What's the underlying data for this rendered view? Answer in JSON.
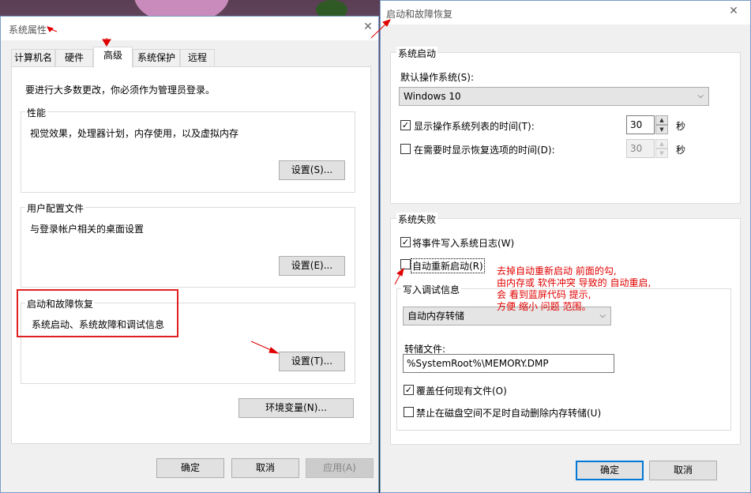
{
  "sys_props": {
    "title": "系统属性",
    "tabs": [
      "计算机名",
      "硬件",
      "高级",
      "系统保护",
      "远程"
    ],
    "admin_notice": "要进行大多数更改，你必须作为管理员登录。",
    "performance": {
      "label": "性能",
      "desc": "视觉效果，处理器计划，内存使用，以及虚拟内存",
      "button": "设置(S)..."
    },
    "user_profiles": {
      "label": "用户配置文件",
      "desc": "与登录帐户相关的桌面设置",
      "button": "设置(E)..."
    },
    "startup_recovery": {
      "label": "启动和故障恢复",
      "desc": "系统启动、系统故障和调试信息",
      "button": "设置(T)..."
    },
    "env_button": "环境变量(N)...",
    "ok": "确定",
    "cancel": "取消",
    "apply": "应用(A)"
  },
  "startup_dialog": {
    "title": "启动和故障恢复",
    "system_startup": {
      "label": "系统启动",
      "default_os_label": "默认操作系统(S):",
      "default_os_value": "Windows 10",
      "show_list_label": "显示操作系统列表的时间(T):",
      "show_list_checked": true,
      "show_list_value": "30",
      "show_recovery_label": "在需要时显示恢复选项的时间(D):",
      "show_recovery_checked": false,
      "show_recovery_value": "30",
      "seconds": "秒"
    },
    "system_failure": {
      "label": "系统失败",
      "write_event_label": "将事件写入系统日志(W)",
      "write_event_checked": true,
      "auto_restart_label": "自动重新启动(R)",
      "auto_restart_checked": false,
      "debug_info_label": "写入调试信息",
      "dump_type": "自动内存转储",
      "dump_file_label": "转储文件:",
      "dump_file_value": "%SystemRoot%\\MEMORY.DMP",
      "overwrite_label": "覆盖任何现有文件(O)",
      "overwrite_checked": true,
      "disable_auto_delete_label": "禁止在磁盘空间不足时自动删除内存转储(U)",
      "disable_auto_delete_checked": false
    },
    "ok": "确定",
    "cancel": "取消"
  },
  "annotation": {
    "lines": [
      "去掉自动重新启动 前面的勾,",
      "由内存或 软件冲突 导致的 自动重启,",
      "会 看到蓝屏代码 提示,",
      "方便 缩小 问题 范围。"
    ]
  },
  "icons": {
    "close": "close-icon",
    "dropdown": "chevron-down-icon",
    "check": "check-icon",
    "spin_up": "spin-up-icon",
    "spin_down": "spin-down-icon"
  },
  "colors": {
    "accent": "#0078d7",
    "annotation_red": "#e00000",
    "window_bg": "#f0f0f0"
  }
}
